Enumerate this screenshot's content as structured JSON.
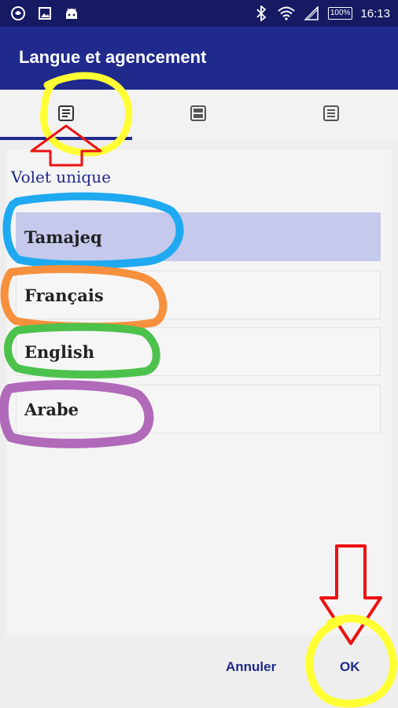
{
  "status_bar": {
    "battery": "100%",
    "time": "16:13"
  },
  "app_bar": {
    "title": "Langue et agencement"
  },
  "tabs": [
    {
      "icon": "single-pane-icon",
      "selected": true
    },
    {
      "icon": "split-pane-icon",
      "selected": false
    },
    {
      "icon": "list-pane-icon",
      "selected": false
    }
  ],
  "panel": {
    "title": "Volet unique",
    "languages": [
      {
        "label": "Tamajeq",
        "selected": true
      },
      {
        "label": "Français",
        "selected": false
      },
      {
        "label": "English",
        "selected": false
      },
      {
        "label": "Arabe",
        "selected": false
      }
    ]
  },
  "dialog_buttons": {
    "cancel": "Annuler",
    "ok": "OK"
  },
  "colors": {
    "status_bar": "#161a63",
    "app_bar": "#1f2a8c",
    "accent": "#1f2a8c",
    "selected_row": "#c5c9ec",
    "highlight_yellow": "#ffff33",
    "arrow_red": "#ee1111",
    "marker_blue": "#1ea9f0",
    "marker_orange": "#f7903c",
    "marker_green": "#4cc24c",
    "marker_purple": "#b06ab9"
  }
}
